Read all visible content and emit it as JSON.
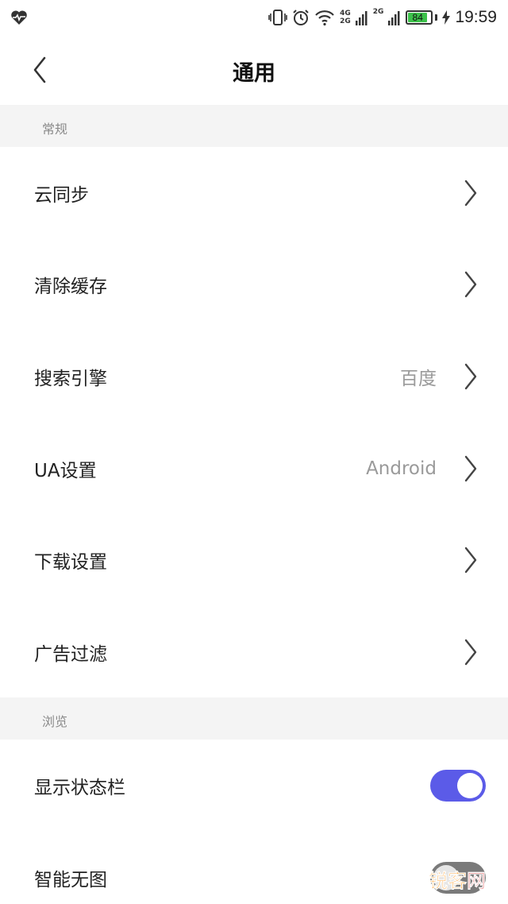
{
  "status_bar": {
    "time": "19:59",
    "battery_level": "84",
    "net_top": "4G",
    "net_bottom": "2G",
    "net_second": "2G",
    "icons": [
      "heart-pulse-icon",
      "vibrate-icon",
      "alarm-icon",
      "wifi-icon",
      "signal-icon",
      "signal-icon",
      "battery-icon",
      "charging-icon"
    ]
  },
  "header": {
    "title": "通用",
    "back_icon": "chevron-left-icon"
  },
  "sections": [
    {
      "title": "常规",
      "items": [
        {
          "label": "云同步",
          "value": ""
        },
        {
          "label": "清除缓存",
          "value": ""
        },
        {
          "label": "搜索引擎",
          "value": "百度"
        },
        {
          "label": "UA设置",
          "value": "Android"
        },
        {
          "label": "下载设置",
          "value": ""
        },
        {
          "label": "广告过滤",
          "value": ""
        }
      ]
    },
    {
      "title": "浏览",
      "items": [
        {
          "label": "显示状态栏",
          "toggle": true
        },
        {
          "label": "智能无图",
          "toggle": false
        }
      ]
    }
  ],
  "watermark": {
    "part1": "锐客",
    "part2": "网"
  },
  "colors": {
    "accent": "#5b5be8",
    "section_bg": "#f4f4f4",
    "battery_green": "#3cc14a",
    "toggle_off": "#7a7a7a"
  }
}
